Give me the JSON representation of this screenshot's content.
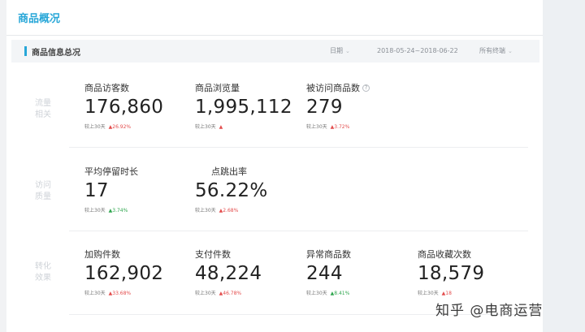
{
  "page_title": "商品概况",
  "section": {
    "title": "商品信息总况",
    "filters": {
      "date_label": "日期",
      "date_range": "2018-05-24~2018-06-22",
      "terminal": "所有终端"
    }
  },
  "categories": {
    "traffic": "流量\n相关",
    "visit": "访问\n质量",
    "conversion": "转化\n效果"
  },
  "compare_label": "较上30天",
  "metrics": {
    "visitors": {
      "label": "商品访客数",
      "value": "176,860",
      "change": "▲26.92%"
    },
    "views": {
      "label": "商品浏览量",
      "value": "1,995,112",
      "change": "▲"
    },
    "visited_items": {
      "label": "被访问商品数",
      "value": "279",
      "change": "▲3.72%"
    },
    "avg_stay": {
      "label": "平均停留时长",
      "value": "17",
      "change": "▲3.74%"
    },
    "bounce_rate": {
      "label": "点跳出率",
      "value": "56.22%",
      "change": "▲2.68%"
    },
    "cart_items": {
      "label": "加购件数",
      "value": "162,902",
      "change": "▲33.68%"
    },
    "paid_items": {
      "label": "支付件数",
      "value": "48,224",
      "change": "▲46.78%"
    },
    "abnormal_items": {
      "label": "异常商品数",
      "value": "244",
      "change": "▲8.41%"
    },
    "favorites": {
      "label": "商品收藏次数",
      "value": "18,579",
      "change": "▲18"
    }
  },
  "watermark": "知乎 @电商运营",
  "colors": {
    "accent": "#28a7d8",
    "increase": "#e34d4d",
    "increase_green": "#2fa64e"
  }
}
